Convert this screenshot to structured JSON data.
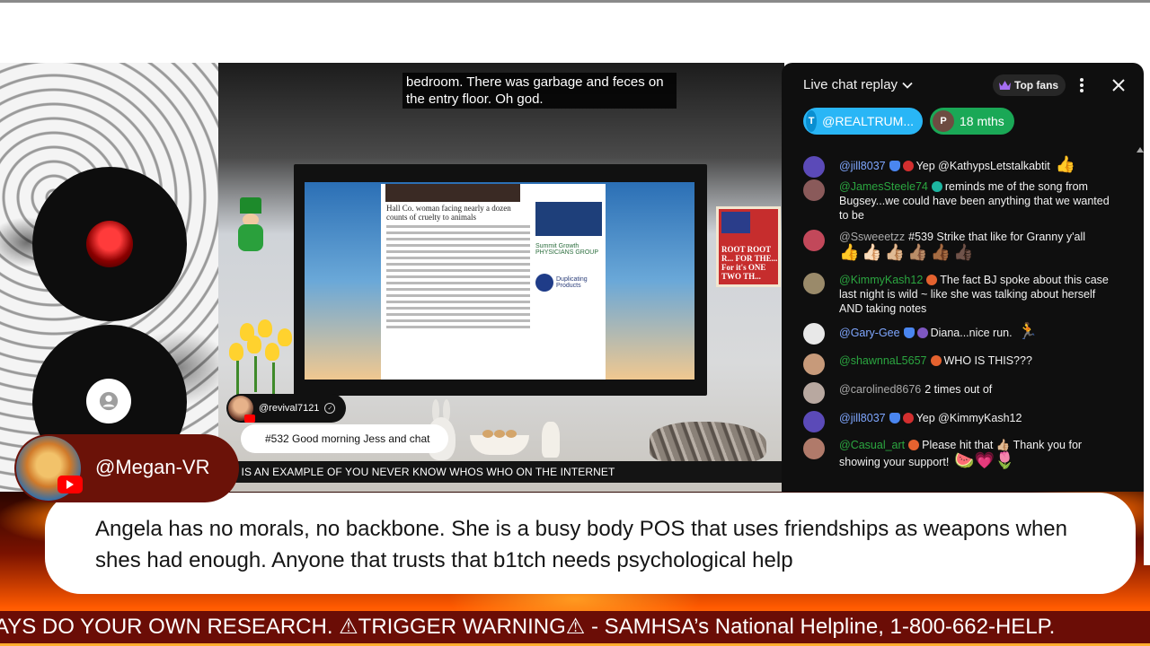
{
  "video": {
    "caption": "bedroom. There was garbage and feces on the entry floor. Oh god.",
    "article": {
      "headline": "Hall Co. woman facing nearly a dozen counts of cruelty to animals",
      "side_logo_1": "Summit Growth PHYSICIANS GROUP",
      "side_logo_2": "Duplicating Products"
    },
    "sign_text": "ROOT ROOT R... FOR THE... For it's ONE TWO TH...",
    "chat_overlay": {
      "username": "@revival7121",
      "message": "#532 Good morning Jess and chat"
    },
    "inner_ticker": "S IS AN EXAMPLE OF YOU NEVER KNOW WHOS WHO ON THE INTERNET"
  },
  "chat": {
    "title": "Live chat replay",
    "top_fans_label": "Top fans",
    "pinned": [
      {
        "initial": "T",
        "label": "@REALTRUM..."
      },
      {
        "initial": "P",
        "label": "18 mths"
      }
    ],
    "messages": [
      {
        "author": "@jill8037",
        "author_color": "#7fa7ff",
        "avatar": "#5b4ab8",
        "badges": [
          "blue",
          "red"
        ],
        "text": "Yep @KathypsLetstalkabtit",
        "emoji": "👍"
      },
      {
        "author": "@JamesSteele74",
        "author_color": "#2ba640",
        "avatar": "#8a5a5a",
        "badges": [
          "teal"
        ],
        "text": "reminds me of the song from Bugsey...we could have been anything that we wanted to be",
        "emoji": ""
      },
      {
        "author": "@Ssweeetzz",
        "author_color": "#aaaaaa",
        "avatar": "#c2485a",
        "badges": [],
        "text": "#539 Strike that like for Granny y'all",
        "emoji": "👍👍🏻👍🏼👍🏽👍🏾👍🏿"
      },
      {
        "author": "@KimmyKash12",
        "author_color": "#2ba640",
        "avatar": "#9a8a6a",
        "badges": [
          "orange"
        ],
        "text": "The fact BJ spoke about this case last night is wild ~ like she was talking about herself AND taking notes",
        "emoji": ""
      },
      {
        "author": "@Gary-Gee",
        "author_color": "#7fa7ff",
        "avatar": "#e8e8e8",
        "badges": [
          "blue",
          "purple"
        ],
        "text": "Diana...nice run.",
        "emoji": "🏃"
      },
      {
        "author": "@shawnnaL5657",
        "author_color": "#2ba640",
        "avatar": "#c79a7a",
        "badges": [
          "orange"
        ],
        "text": "WHO IS THIS???",
        "emoji": ""
      },
      {
        "author": "@carolined8676",
        "author_color": "#aaaaaa",
        "avatar": "#b8a8a0",
        "badges": [],
        "text": "2 times out of",
        "emoji": ""
      },
      {
        "author": "@jill8037",
        "author_color": "#7fa7ff",
        "avatar": "#5b4ab8",
        "badges": [
          "blue",
          "red"
        ],
        "text": "Yep @KimmyKash12",
        "emoji": ""
      },
      {
        "author": "@Casual_art",
        "author_color": "#2ba640",
        "avatar": "#b07a6a",
        "badges": [
          "orange"
        ],
        "text": "Please hit that 👍🏼 Thank you for showing your support!",
        "emoji": "🍉💗🌷"
      }
    ]
  },
  "featured": {
    "name": "@Megan-VR",
    "message": "Angela has no morals, no backbone. She is a busy body POS that uses friendships as weapons when shes had enough. Anyone that trusts that b1tch needs psychological help"
  },
  "ticker": "AYS DO YOUR OWN RESEARCH. ⚠TRIGGER WARNING⚠ - SAMHSA’s National Helpline, 1-800-662-HELP.",
  "colors": {
    "chat_bg": "#0f0f0f",
    "ticker_bg": "#6b0d06",
    "pin_chip_1": "#29b6f6",
    "pin_chip_2": "#1aa856"
  }
}
